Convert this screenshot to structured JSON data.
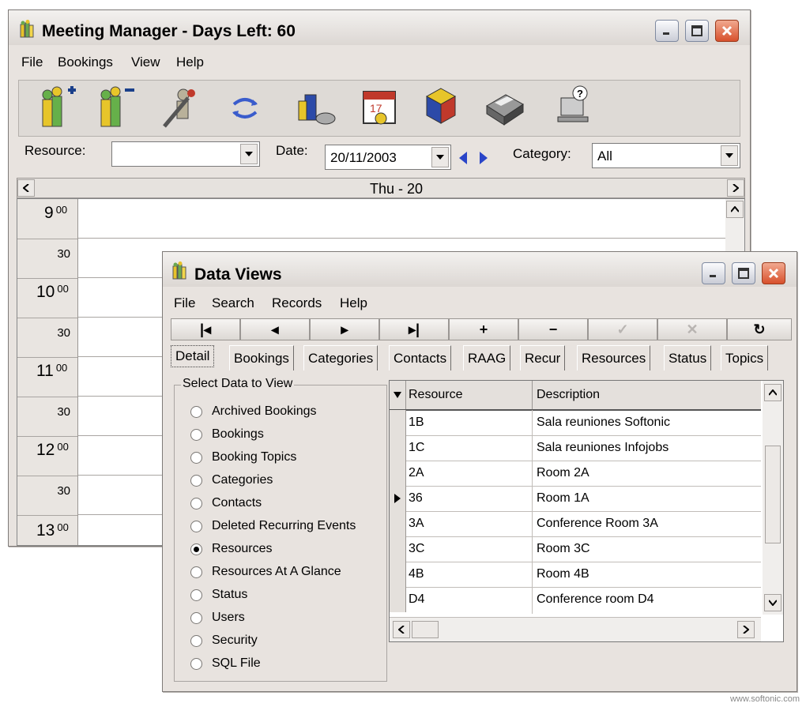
{
  "main_window": {
    "title": "Meeting Manager - Days Left: 60",
    "menu": [
      "File",
      "Bookings",
      "View",
      "Help"
    ],
    "toolbar_icons": [
      "add-booking-icon",
      "remove-booking-icon",
      "edit-booking-icon",
      "refresh-icon",
      "resources-icon",
      "calendar-icon",
      "categories-icon",
      "print-icon",
      "help-icon"
    ],
    "resource_label": "Resource:",
    "resource_value": "",
    "date_label": "Date:",
    "date_value": "20/11/2003",
    "category_label": "Category:",
    "category_value": "All",
    "day_header": "Thu - 20",
    "time_slots": [
      {
        "hour": "9",
        "min": "00"
      },
      {
        "half": "30"
      },
      {
        "hour": "10",
        "min": "00"
      },
      {
        "half": "30"
      },
      {
        "hour": "11",
        "min": "00"
      },
      {
        "half": "30"
      },
      {
        "hour": "12",
        "min": "00"
      },
      {
        "half": "30"
      },
      {
        "hour": "13",
        "min": "00"
      }
    ]
  },
  "data_window": {
    "title": "Data Views",
    "menu": [
      "File",
      "Search",
      "Records",
      "Help"
    ],
    "nav_buttons": [
      "|◂",
      "◂",
      "▸",
      "▸|",
      "+",
      "−",
      "✓",
      "✕",
      "↻"
    ],
    "tabs": [
      "Detail",
      "Bookings",
      "Categories",
      "Contacts",
      "RAAG",
      "Recur",
      "Resources",
      "Status",
      "Topics"
    ],
    "group_title": "Select Data to View",
    "options": [
      "Archived Bookings",
      "Bookings",
      "Booking Topics",
      "Categories",
      "Contacts",
      "Deleted Recurring Events",
      "Resources",
      "Resources At A Glance",
      "Status",
      "Users",
      "Security",
      "SQL File"
    ],
    "selected_option": "Resources",
    "grid_headers": [
      "Resource",
      "Description"
    ],
    "grid_rows": [
      {
        "resource": "1B",
        "description": "Sala reuniones Softonic"
      },
      {
        "resource": "1C",
        "description": "Sala reuniones Infojobs"
      },
      {
        "resource": "2A",
        "description": "Room 2A"
      },
      {
        "resource": "36",
        "description": "Room 1A"
      },
      {
        "resource": "3A",
        "description": "Conference Room 3A"
      },
      {
        "resource": "3C",
        "description": "Room 3C"
      },
      {
        "resource": "4B",
        "description": "Room 4B"
      },
      {
        "resource": "D4",
        "description": "Conference room D4"
      }
    ],
    "current_row": 3
  },
  "watermark": "www.softonic.com"
}
